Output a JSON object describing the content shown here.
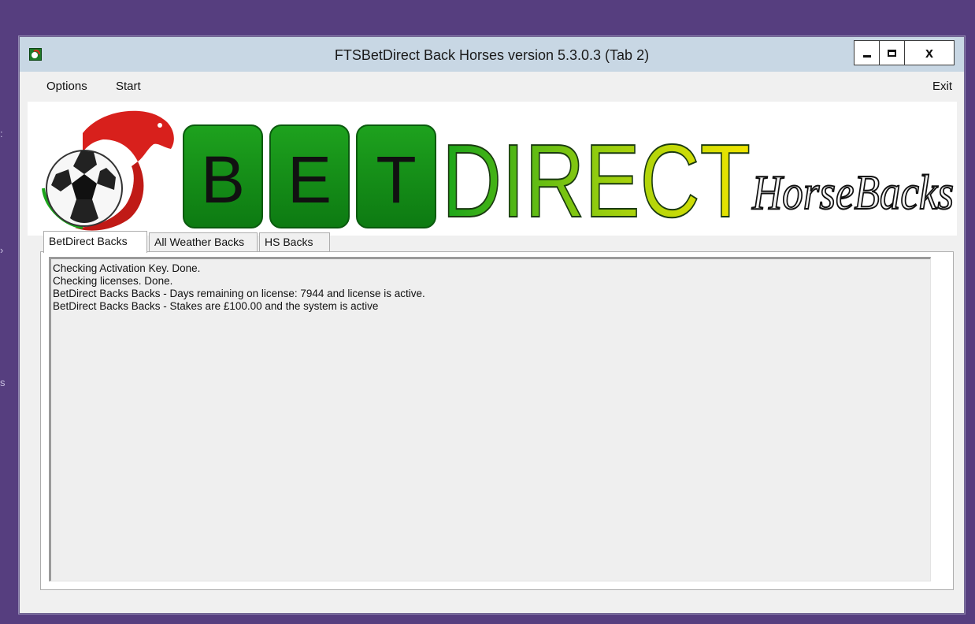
{
  "window": {
    "title": "FTSBetDirect Back Horses  version 5.3.0.3 (Tab 2)",
    "controls": {
      "close_label": "x"
    }
  },
  "menu": {
    "options_label": "Options",
    "start_label": "Start",
    "exit_label": "Exit"
  },
  "banner": {
    "letters": [
      "B",
      "E",
      "T"
    ],
    "word": "DIRECT",
    "script": "HorseBacks",
    "colors": {
      "tile_green": "#16921c",
      "direct_green": "#1aa51a",
      "direct_yellow": "#f2e600",
      "horse_red": "#d8201c"
    }
  },
  "tabs": [
    {
      "label": "BetDirect Backs",
      "active": true
    },
    {
      "label": "All Weather Backs",
      "active": false
    },
    {
      "label": "HS Backs",
      "active": false
    }
  ],
  "log": {
    "lines": [
      "Checking Activation Key. Done.",
      "Checking licenses. Done.",
      "BetDirect Backs Backs - Days remaining on license: 7944 and license is active.",
      "BetDirect Backs Backs - Stakes are £100.00 and the system is active"
    ]
  },
  "icons": [
    "app-icon",
    "minimize-icon",
    "maximize-icon",
    "close-icon",
    "soccer-ball-icon",
    "horse-head-icon"
  ],
  "theme": {
    "desktop_bg": "#563e7f",
    "titlebar_bg": "#c8d7e4",
    "window_bg": "#f0f0f0"
  }
}
